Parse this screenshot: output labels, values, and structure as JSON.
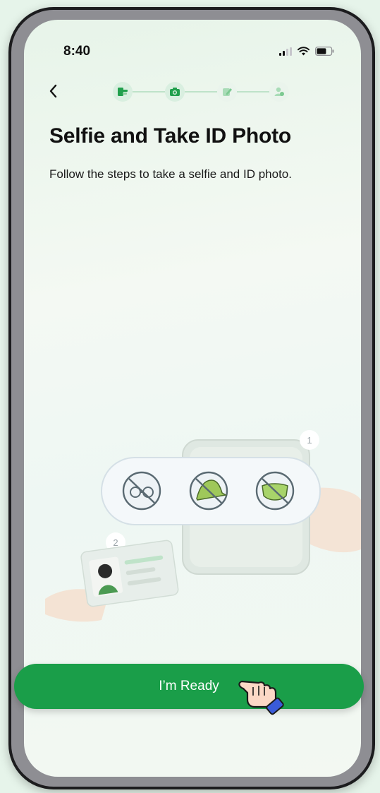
{
  "status_bar": {
    "time": "8:40",
    "icons": [
      "cellular-signal-icon",
      "wifi-icon",
      "battery-icon"
    ]
  },
  "nav": {
    "back_icon": "chevron-left-icon",
    "steps": [
      {
        "icon": "id-card-icon",
        "state": "active"
      },
      {
        "icon": "camera-icon",
        "state": "active"
      },
      {
        "icon": "edit-icon",
        "state": "inactive"
      },
      {
        "icon": "user-check-icon",
        "state": "inactive"
      }
    ]
  },
  "page": {
    "title": "Selfie and Take ID Photo",
    "subtitle": "Follow the steps to take a selfie and ID photo."
  },
  "illustration": {
    "step_badges": [
      "1",
      "2"
    ],
    "forbidden_items": [
      "no-glasses-icon",
      "no-hat-icon",
      "no-mask-icon"
    ]
  },
  "actions": {
    "primary_label": "I’m Ready"
  },
  "colors": {
    "accent": "#1a9e49",
    "background": "#e6f4ea",
    "step_active": "#d9efe0"
  }
}
